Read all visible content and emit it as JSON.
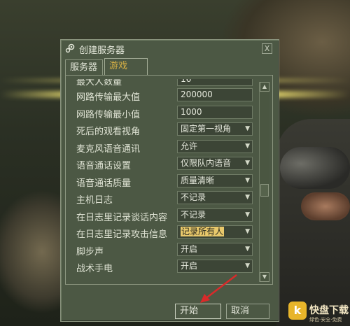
{
  "dialog": {
    "title": "创建服务器",
    "close": "X",
    "tabs": [
      "服务器",
      "游戏"
    ],
    "active_tab": "游戏",
    "partial_row_label": "最大人数量"
  },
  "settings": [
    {
      "label": "网路传输最大值",
      "value": "200000",
      "type": "input"
    },
    {
      "label": "网路传输最小值",
      "value": "1000",
      "type": "input"
    },
    {
      "label": "死后的观看视角",
      "value": "固定第一视角",
      "type": "select"
    },
    {
      "label": "麦克风语音通讯",
      "value": "允许",
      "type": "select"
    },
    {
      "label": "语音通话设置",
      "value": "仅限队内语音",
      "type": "select"
    },
    {
      "label": "语音通话质量",
      "value": "质量清晰",
      "type": "select"
    },
    {
      "label": "主机日志",
      "value": "不记录",
      "type": "select"
    },
    {
      "label": "在日志里记录谈话内容",
      "value": "不记录",
      "type": "select"
    },
    {
      "label": "在日志里记录攻击信息",
      "value": "记录所有人",
      "type": "select",
      "highlighted": true
    },
    {
      "label": "脚步声",
      "value": "开启",
      "type": "select"
    },
    {
      "label": "战术手电",
      "value": "开启",
      "type": "select"
    }
  ],
  "buttons": {
    "start": "开始",
    "cancel": "取消"
  },
  "watermark": {
    "logo_char": "k",
    "name": "快盘下载",
    "sub": "绿色·安全·免费"
  },
  "colors": {
    "panel": "#4c5844",
    "text": "#dfe3d4",
    "accent": "#d7b045",
    "highlight": "#e8c86b",
    "pointer": "#d92a2a"
  }
}
